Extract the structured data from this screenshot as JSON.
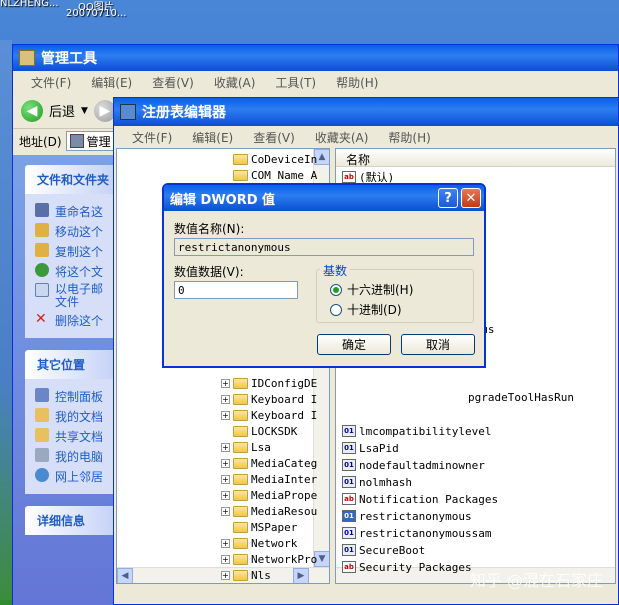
{
  "desktop": {
    "icon_label_1": "NLZHENG...",
    "icon_label_2": "QQ图片",
    "icon_label_3": "20070710..."
  },
  "admin_window": {
    "title": "管理工具",
    "menu": [
      "文件(F)",
      "编辑(E)",
      "查看(V)",
      "收藏(A)",
      "工具(T)",
      "帮助(H)"
    ],
    "back_label": "后退",
    "address_label": "地址(D)",
    "address_value": "管理",
    "taskpane": {
      "files_header": "文件和文件夹",
      "files_items": [
        "重命名这",
        "移动这个",
        "复制这个",
        "将这个文",
        "以电子邮",
        "文件",
        "删除这个"
      ],
      "other_header": "其它位置",
      "other_items": [
        "控制面板",
        "我的文档",
        "共享文档",
        "我的电脑",
        "网上邻居"
      ],
      "details_header": "详细信息"
    }
  },
  "regedit_window": {
    "title": "注册表编辑器",
    "menu": [
      "文件(F)",
      "编辑(E)",
      "查看(V)",
      "收藏夹(A)",
      "帮助(H)"
    ],
    "tree_items": [
      {
        "label": "CoDeviceIn",
        "expander": ""
      },
      {
        "label": "COM Name A",
        "expander": ""
      },
      {
        "label": "IDConfigDE",
        "expander": "+"
      },
      {
        "label": "Keyboard I",
        "expander": "+"
      },
      {
        "label": "Keyboard I",
        "expander": "+"
      },
      {
        "label": "LOCKSDK",
        "expander": ""
      },
      {
        "label": "Lsa",
        "expander": "+"
      },
      {
        "label": "MediaCateg",
        "expander": "+"
      },
      {
        "label": "MediaInter",
        "expander": "+"
      },
      {
        "label": "MediaPrope",
        "expander": "+"
      },
      {
        "label": "MediaResou",
        "expander": "+"
      },
      {
        "label": "MSPaper",
        "expander": ""
      },
      {
        "label": "Network",
        "expander": "+"
      },
      {
        "label": "NetworkPro",
        "expander": "+"
      },
      {
        "label": "Nls",
        "expander": "+"
      }
    ],
    "values_header": "名称",
    "values_top": [
      {
        "label": "(默认)",
        "type": "sz"
      }
    ],
    "values_partial": [
      "es",
      "nous",
      "pgradeToolHasRun"
    ],
    "values": [
      {
        "label": "lmcompatibilitylevel",
        "type": "bin"
      },
      {
        "label": "LsaPid",
        "type": "bin"
      },
      {
        "label": "nodefaultadminowner",
        "type": "bin"
      },
      {
        "label": "nolmhash",
        "type": "bin"
      },
      {
        "label": "Notification Packages",
        "type": "sz"
      },
      {
        "label": "restrictanonymous",
        "type": "sel"
      },
      {
        "label": "restrictanonymoussam",
        "type": "bin"
      },
      {
        "label": "SecureBoot",
        "type": "bin"
      },
      {
        "label": "Security Packages",
        "type": "sz"
      }
    ]
  },
  "dialog": {
    "title": "编辑 DWORD 值",
    "help_glyph": "?",
    "close_glyph": "✕",
    "value_name_label": "数值名称(N):",
    "value_name": "restrictanonymous",
    "value_data_label": "数值数据(V):",
    "value_data": "0",
    "base_label": "基数",
    "radio_hex": "十六进制(H)",
    "radio_dec": "十进制(D)",
    "selected_base": "hex",
    "ok": "确定",
    "cancel": "取消"
  },
  "watermark": "知乎 @混在石家庄"
}
